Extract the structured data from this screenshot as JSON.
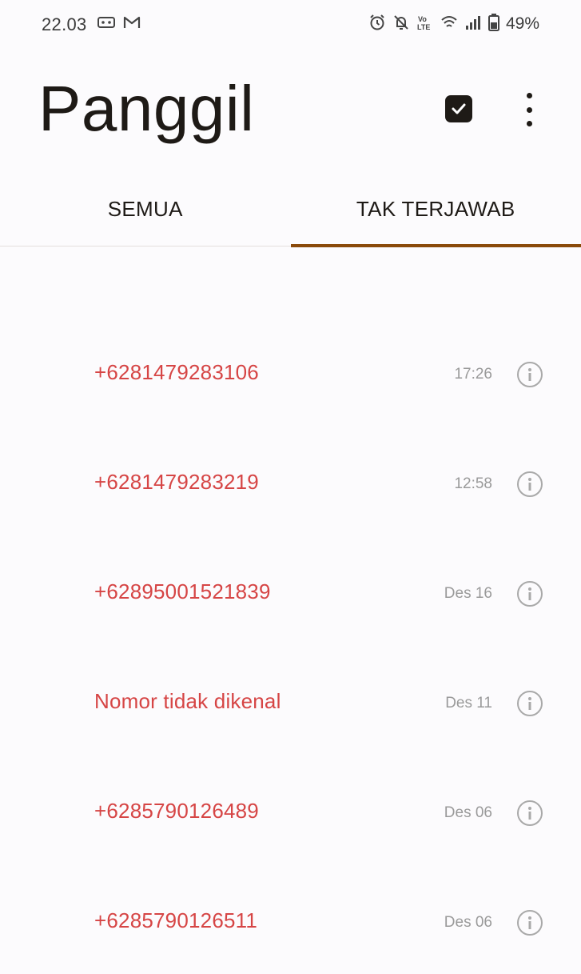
{
  "status_bar": {
    "time": "22.03",
    "battery_percent": "49%",
    "left_icons": [
      "voicemail-icon",
      "gmail-icon"
    ],
    "right_icons": [
      "alarm-icon",
      "notifications-off-icon",
      "volte-icon",
      "wifi-icon",
      "signal-icon",
      "battery-icon"
    ]
  },
  "header": {
    "title": "Panggil"
  },
  "tabs": [
    {
      "label": "SEMUA",
      "active": false
    },
    {
      "label": "TAK TERJAWAB",
      "active": true
    }
  ],
  "calls": [
    {
      "name": "+6281479283106",
      "time": "17:26"
    },
    {
      "name": "+6281479283219",
      "time": "12:58"
    },
    {
      "name": "+62895001521839",
      "time": "Des 16"
    },
    {
      "name": "Nomor tidak dikenal",
      "time": "Des 11"
    },
    {
      "name": "+6285790126489",
      "time": "Des 06"
    },
    {
      "name": "+6285790126511",
      "time": "Des 06"
    }
  ],
  "colors": {
    "accent": "#8a4a0a",
    "missed_call": "#d64545",
    "background": "#fcfbfd",
    "time_text": "#9a9a9a"
  }
}
